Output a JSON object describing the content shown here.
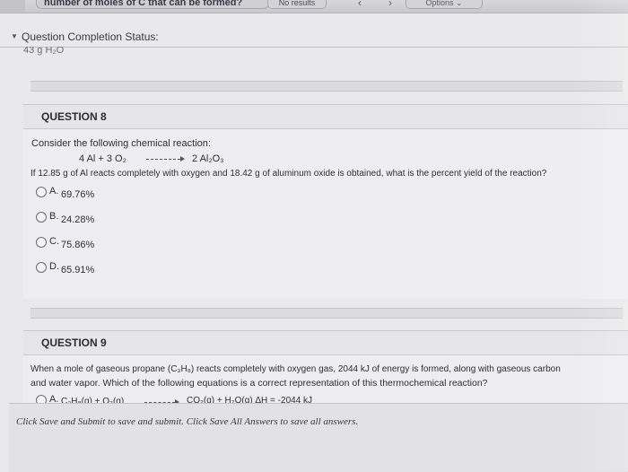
{
  "findbar": {
    "query": "number of moles of C that can be formed?",
    "results": "No results",
    "prev": "‹",
    "next": "›",
    "options": "Options ⌄"
  },
  "completion": {
    "label": "Question Completion Status:",
    "clipped_text": "43 g H₂O"
  },
  "q8": {
    "header": "QUESTION 8",
    "prompt": "Consider the following chemical reaction:",
    "eq_left": "4 Al  +  3 O₂",
    "eq_right": "2 Al₂O₃",
    "question": "If 12.85 g of Al reacts completely with oxygen and 18.42 g of aluminum oxide is obtained, what is the percent yield of the reaction?",
    "options": [
      {
        "letter": "A.",
        "value": "69.76%"
      },
      {
        "letter": "B.",
        "value": "24.28%"
      },
      {
        "letter": "C.",
        "value": "75.86%"
      },
      {
        "letter": "D.",
        "value": "65.91%"
      }
    ]
  },
  "q9": {
    "header": "QUESTION 9",
    "line1": "When a mole of gaseous propane (C₃H₈) reacts completely with oxygen gas, 2044 kJ of energy is formed, along with gaseous carbon",
    "line2": "and water vapor.  Which of the following equations is a correct representation of this thermochemical reaction?",
    "option_a_letter": "A.",
    "option_a_left": "C₃H₈(g)  +  O₂(g)",
    "option_a_right": "CO₂(g)  +  H₂O(g)   ΔH = -2044 kJ"
  },
  "footer": {
    "note": "Click Save and Submit to save and submit. Click Save All Answers to save all answers."
  }
}
